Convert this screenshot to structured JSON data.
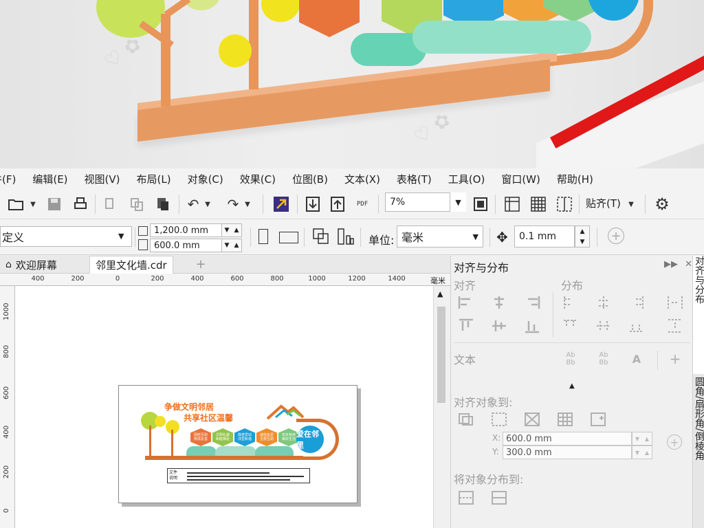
{
  "menu": {
    "items": [
      "件(F)",
      "编辑(E)",
      "视图(V)",
      "布局(L)",
      "对象(C)",
      "效果(C)",
      "位图(B)",
      "文本(X)",
      "表格(T)",
      "工具(O)",
      "窗口(W)",
      "帮助(H)"
    ]
  },
  "toolbar": {
    "pdf_label": "PDF",
    "zoom_value": "7%",
    "paste_label": "贴齐(T)",
    "icons": [
      "open-folder-icon",
      "save-icon",
      "print-icon",
      "cut-icon",
      "copy-icon",
      "paste-icon",
      "undo-icon",
      "redo-icon",
      "corel-connect-icon",
      "import-icon",
      "export-icon",
      "publish-pdf-icon",
      "full-screen-icon",
      "show-rulers-icon",
      "show-grid-icon",
      "show-guidelines-icon",
      "options-gear-icon"
    ]
  },
  "property_bar": {
    "page_preset": "定义",
    "width": "1,200.0 mm",
    "height": "600.0 mm",
    "unit_label": "单位:",
    "unit_value": "毫米",
    "nudge": "0.1 mm"
  },
  "tabs": {
    "welcome": "欢迎屏幕",
    "document": "邻里文化墙.cdr"
  },
  "ruler": {
    "h_ticks": [
      "400",
      "200",
      "0",
      "200",
      "400",
      "600",
      "800",
      "1000",
      "1200",
      "1400"
    ],
    "unit": "毫米",
    "v_ticks": [
      "1000",
      "800",
      "600",
      "400",
      "200",
      "0"
    ]
  },
  "design": {
    "title_line1": "争做文明邻居",
    "title_line2": "共享社区温馨",
    "hexes": [
      {
        "text": "团结互助\n热情友善",
        "color": "#e8743b"
      },
      {
        "text": "文明礼貌\n和睦相处",
        "color": "#93c44b"
      },
      {
        "text": "尊老爱幼\n邻里和谐",
        "color": "#1d9fd9"
      },
      {
        "text": "诚信友爱\n互帮互助",
        "color": "#f08c2e"
      },
      {
        "text": "安定有序\n美好生活",
        "color": "#7ec87f"
      }
    ],
    "love_badge": "爱在邻里",
    "note_label": "文件\n说明"
  },
  "docker": {
    "title": "对齐与分布",
    "section_align": "对齐",
    "section_distribute": "分布",
    "section_text": "文本",
    "section_align_to": "对齐对象到:",
    "x_label": "X:",
    "x_value": "600.0 mm",
    "y_label": "Y:",
    "y_value": "300.0 mm",
    "section_distribute_to": "将对象分布到:"
  },
  "side_tabs": {
    "tab1": "对齐与分布",
    "tab2": "圆角/扇形角/倒棱角"
  },
  "colors": {
    "accent_orange": "#e8955a",
    "rail_red": "#e01818"
  }
}
